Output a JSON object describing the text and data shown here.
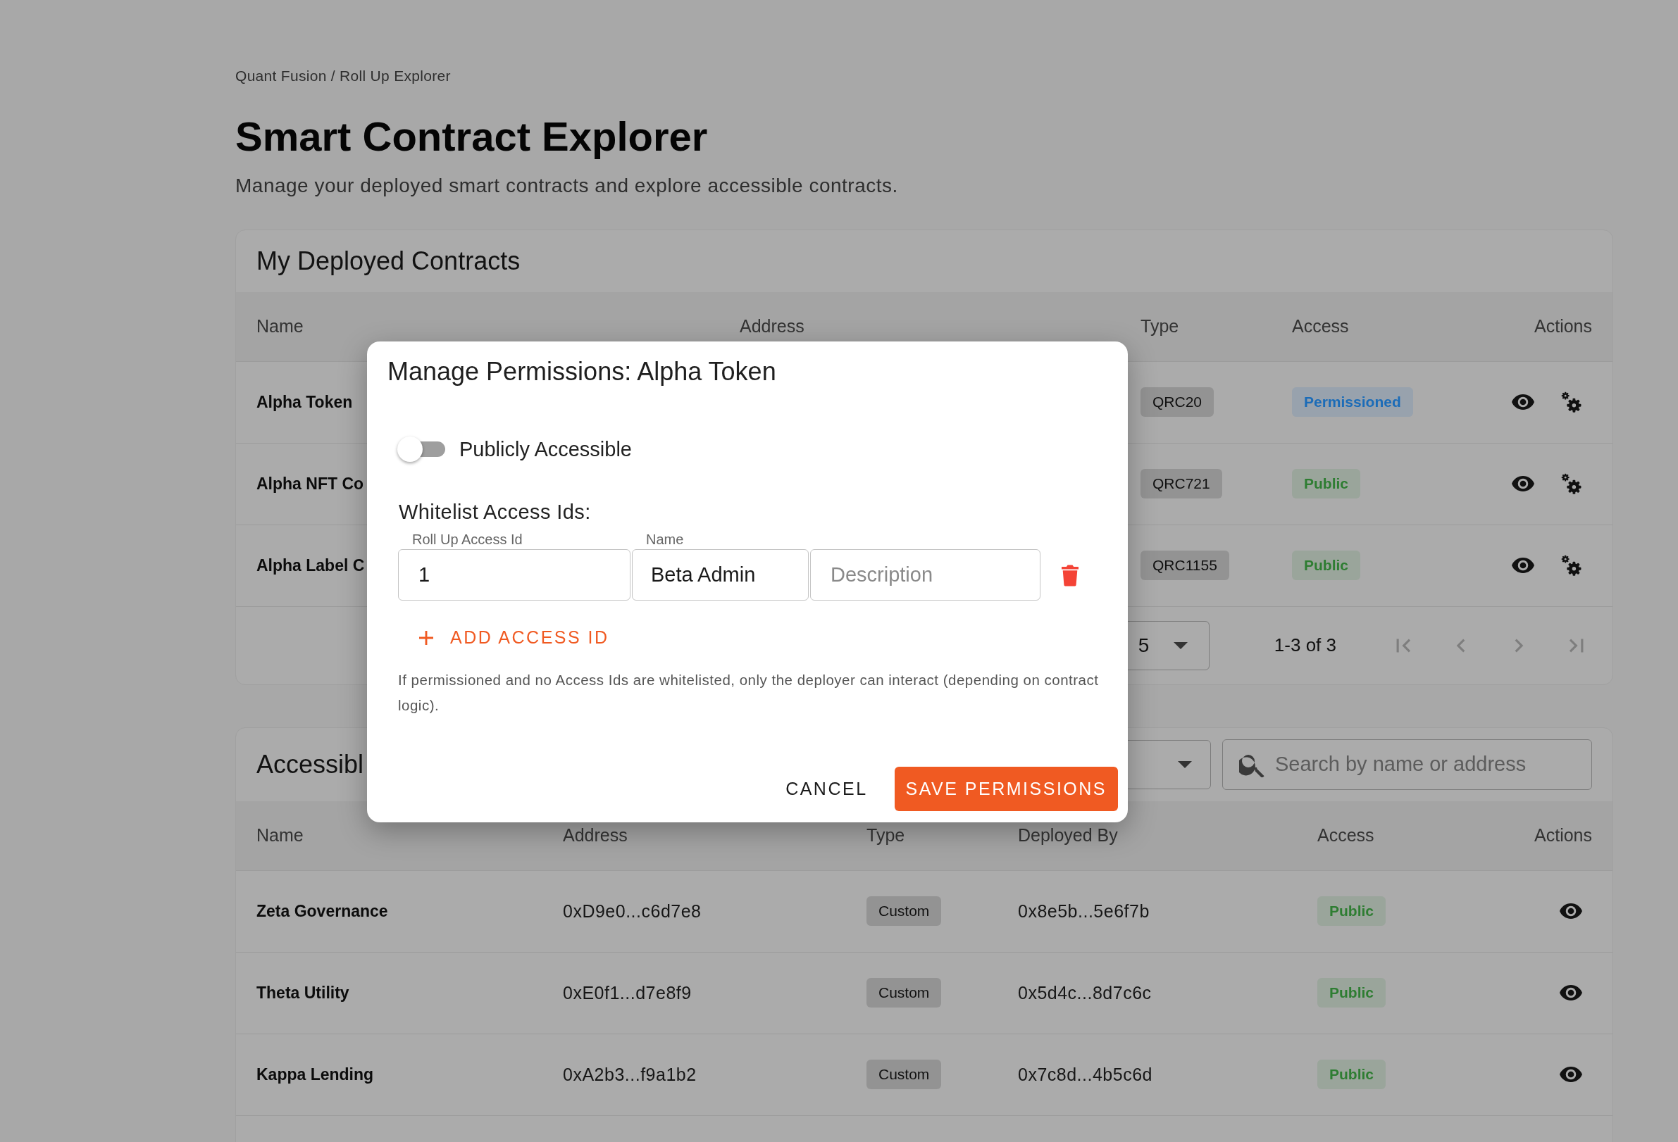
{
  "breadcrumb": "Quant Fusion / Roll Up Explorer",
  "title": "Smart Contract Explorer",
  "subtitle": "Manage your deployed smart contracts and explore accessible contracts.",
  "deployed": {
    "title": "My Deployed Contracts",
    "columns": [
      "Name",
      "Address",
      "Type",
      "Access",
      "Actions"
    ],
    "row_actions": [
      {
        "kind": "view"
      },
      {
        "kind": "settings"
      }
    ],
    "rows": [
      {
        "name": "Alpha Token",
        "type": "QRC20",
        "access": {
          "label": "Permissioned",
          "color": "#1b6cb8"
        }
      },
      {
        "name": "Alpha NFT Co",
        "type": "QRC721",
        "access": {
          "label": "Public",
          "color": "#2e7d32"
        }
      },
      {
        "name": "Alpha Label C",
        "type": "QRC1155",
        "access": {
          "label": "Public",
          "color": "#2e7d32"
        }
      }
    ],
    "pagination": {
      "rows_per_page": "5",
      "range": "1-3 of 3",
      "buttons": [
        {
          "kind": "first",
          "disabled": true
        },
        {
          "kind": "prev",
          "disabled": true
        },
        {
          "kind": "next",
          "disabled": true
        },
        {
          "kind": "last",
          "disabled": true
        }
      ]
    }
  },
  "accessible": {
    "title": "Accessibl",
    "search": {
      "placeholder": "Search by name or address"
    },
    "columns": [
      "Name",
      "Address",
      "Type",
      "Deployed By",
      "Access",
      "Actions"
    ],
    "row_actions": [
      {
        "kind": "view"
      }
    ],
    "rows": [
      {
        "name": "Zeta Governance",
        "address": "0xD9e0...c6d7e8",
        "type": "Custom",
        "deployed_by": "0x8e5b...5e6f7b",
        "access": {
          "label": "Public",
          "color": "#2e7d32"
        }
      },
      {
        "name": "Theta Utility",
        "address": "0xE0f1...d7e8f9",
        "type": "Custom",
        "deployed_by": "0x5d4c...8d7c6c",
        "access": {
          "label": "Public",
          "color": "#2e7d32"
        }
      },
      {
        "name": "Kappa Lending",
        "address": "0xA2b3...f9a1b2",
        "type": "Custom",
        "deployed_by": "0x7c8d...4b5c6d",
        "access": {
          "label": "Public",
          "color": "#2e7d32"
        }
      }
    ]
  },
  "dialog": {
    "title": "Manage Permissions: Alpha Token",
    "toggle": {
      "label": "Publicly Accessible",
      "on": false
    },
    "whitelist_label": "Whitelist Access Ids:",
    "entries": [
      {
        "access_id": {
          "label": "Roll Up Access Id",
          "value": "1"
        },
        "name": {
          "label": "Name",
          "value": "Beta Admin"
        },
        "description": {
          "placeholder": "Description"
        }
      }
    ],
    "add_button": "ADD ACCESS ID",
    "note": "If permissioned and no Access Ids are whitelisted, only the deployer can interact (depending on contract logic).",
    "cancel": "CANCEL",
    "save": "SAVE PERMISSIONS"
  }
}
